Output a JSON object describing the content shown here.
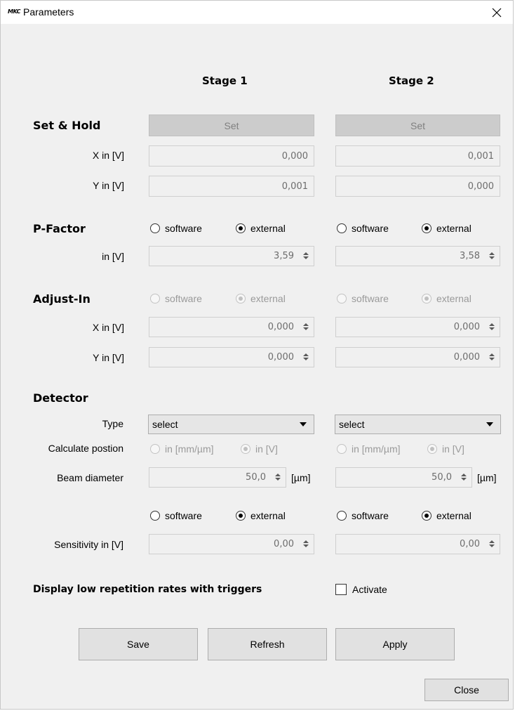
{
  "window": {
    "title": "Parameters",
    "logo_text": "MKC",
    "close_glyph": "✕"
  },
  "columns": {
    "stage1": "Stage 1",
    "stage2": "Stage 2"
  },
  "set_hold": {
    "title": "Set & Hold",
    "set_label": "Set",
    "x_label": "X in [V]",
    "y_label": "Y in [V]",
    "stage1": {
      "x": "0,000",
      "y": "0,001"
    },
    "stage2": {
      "x": "0,001",
      "y": "0,000"
    }
  },
  "p_factor": {
    "title": "P-Factor",
    "software_label": "software",
    "external_label": "external",
    "value_label": "in [V]",
    "stage1": {
      "value": "3,59",
      "selected": "external"
    },
    "stage2": {
      "value": "3,58",
      "selected": "external"
    }
  },
  "adjust_in": {
    "title": "Adjust-In",
    "software_label": "software",
    "external_label": "external",
    "x_label": "X in [V]",
    "y_label": "Y in [V]",
    "stage1": {
      "x": "0,000",
      "y": "0,000",
      "selected": "external"
    },
    "stage2": {
      "x": "0,000",
      "y": "0,000",
      "selected": "external"
    }
  },
  "detector": {
    "title": "Detector",
    "type_label": "Type",
    "calc_label": "Calculate postion",
    "beam_label": "Beam diameter",
    "sensitivity_label": "Sensitivity in [V]",
    "calc_opt1": "in [mm/µm]",
    "calc_opt2": "in [V]",
    "beam_unit": "[µm]",
    "software_label": "software",
    "external_label": "external",
    "stage1": {
      "type": "select",
      "calc_selected": "in [V]",
      "beam": "50,0",
      "mode_selected": "external",
      "sensitivity": "0,00"
    },
    "stage2": {
      "type": "select",
      "calc_selected": "in [V]",
      "beam": "50,0",
      "mode_selected": "external",
      "sensitivity": "0,00"
    }
  },
  "low_rep": {
    "label": "Display low repetition rates with triggers",
    "checkbox_label": "Activate",
    "checked": false
  },
  "buttons": {
    "save": "Save",
    "refresh": "Refresh",
    "apply": "Apply",
    "close": "Close"
  }
}
